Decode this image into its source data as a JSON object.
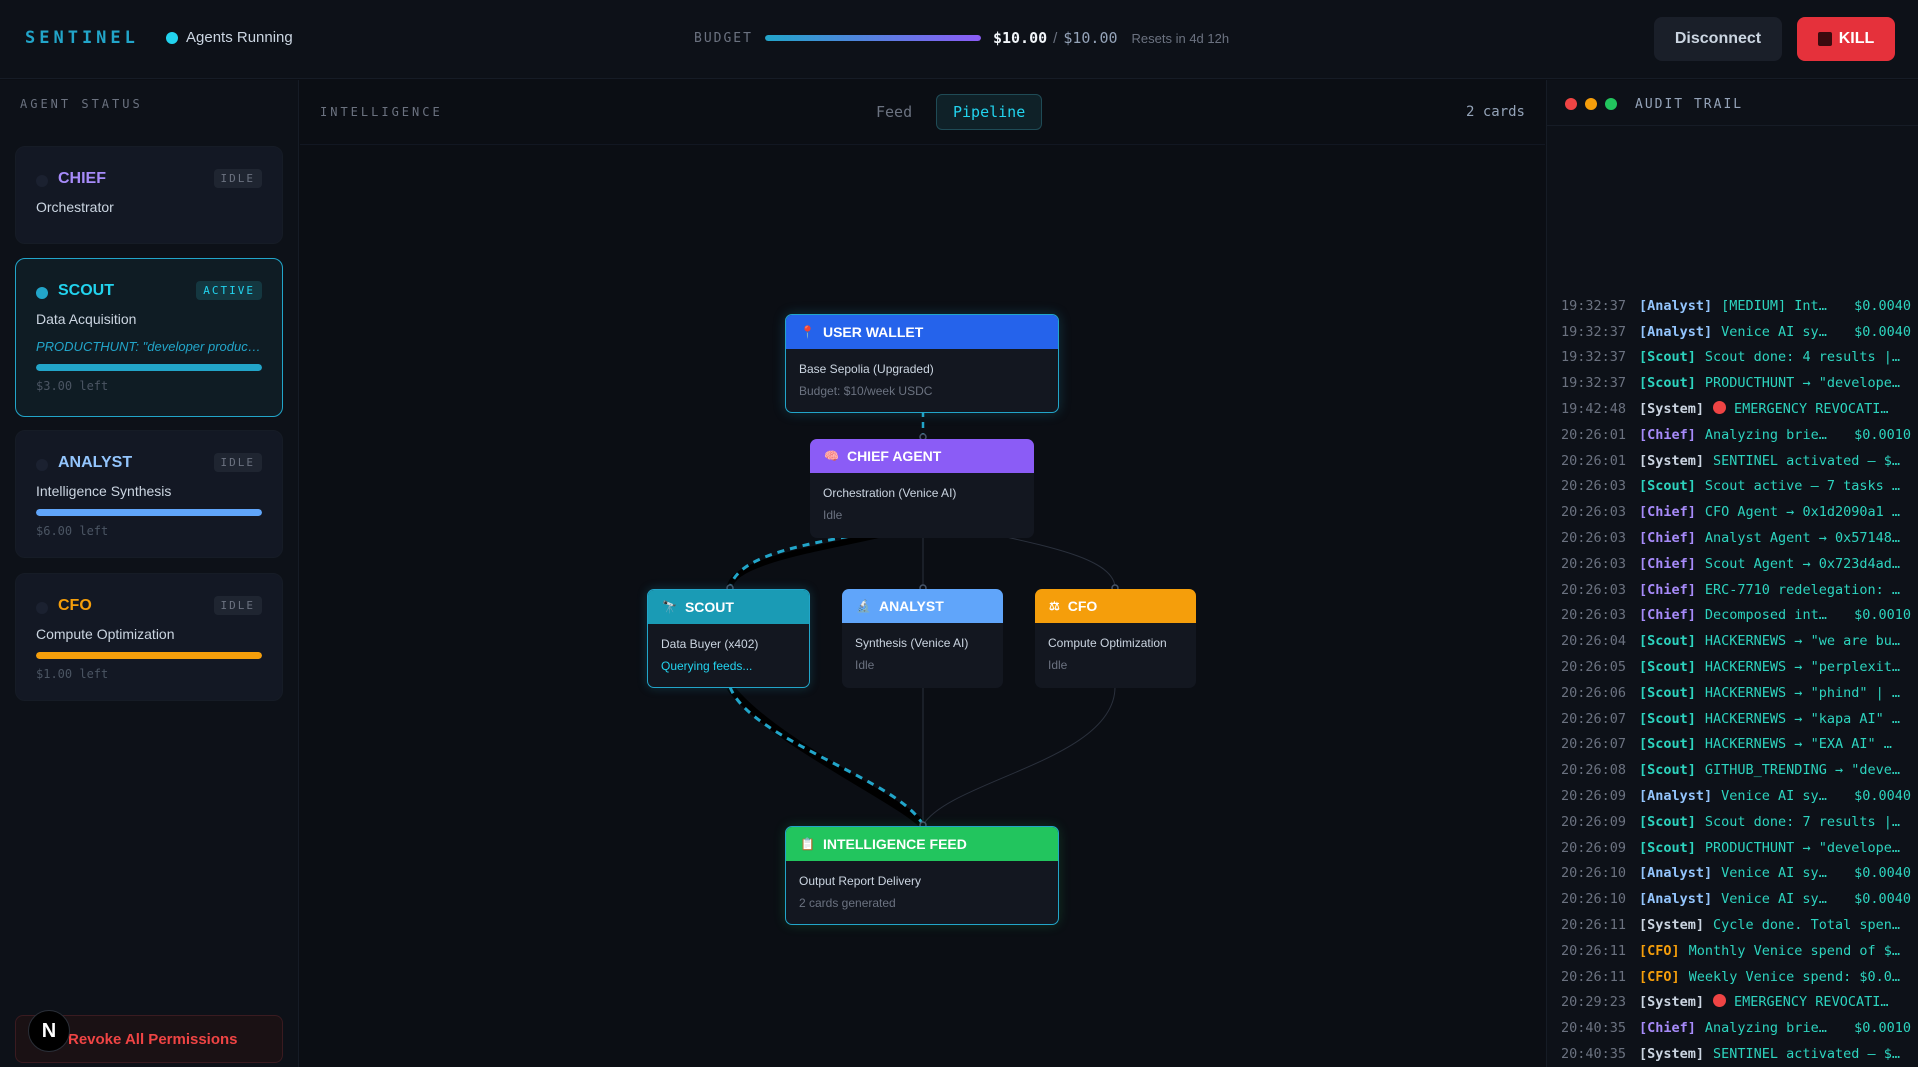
{
  "header": {
    "brand": "SENTINEL",
    "status": "Agents Running",
    "budget_label": "BUDGET",
    "budget_spent": "$10.00",
    "budget_sep": "/",
    "budget_total": "$10.00",
    "budget_fraction": 1.0,
    "budget_reset": "Resets in 4d 12h",
    "disconnect_label": "Disconnect",
    "kill_label": "KILL"
  },
  "sidebar": {
    "title": "AGENT STATUS",
    "agents": [
      {
        "name": "CHIEF",
        "role": "Orchestrator",
        "badge": "IDLE",
        "color": "#a78bfa"
      },
      {
        "name": "SCOUT",
        "role": "Data Acquisition",
        "badge": "ACTIVE",
        "note": "PRODUCTHUNT: \"developer product...",
        "left": "$3.00 left",
        "bar_fraction": 1.0,
        "color": "#22a5c9"
      },
      {
        "name": "ANALYST",
        "role": "Intelligence Synthesis",
        "badge": "IDLE",
        "left": "$6.00 left",
        "bar_fraction": 1.0,
        "color": "#60a5fa"
      },
      {
        "name": "CFO",
        "role": "Compute Optimization",
        "badge": "IDLE",
        "left": "$1.00 left",
        "bar_fraction": 1.0,
        "color": "#f59e0b"
      }
    ],
    "revoke_label": "Revoke All Permissions",
    "n_badge": "N"
  },
  "center": {
    "title": "INTELLIGENCE",
    "tabs": [
      "Feed",
      "Pipeline"
    ],
    "active_tab": "Pipeline",
    "cards_count": "2 cards",
    "nodes": {
      "wallet": {
        "title": "USER WALLET",
        "icon": "📍",
        "sub": "Base Sepolia (Upgraded)",
        "sub2": "Budget: $10/week USDC"
      },
      "chief": {
        "title": "CHIEF AGENT",
        "icon": "🧠",
        "sub": "Orchestration (Venice AI)",
        "sub2": "Idle"
      },
      "scout": {
        "title": "SCOUT",
        "icon": "🔭",
        "sub": "Data Buyer (x402)",
        "sub2": "Querying feeds..."
      },
      "analyst": {
        "title": "ANALYST",
        "icon": "🔬",
        "sub": "Synthesis (Venice AI)",
        "sub2": "Idle"
      },
      "cfo": {
        "title": "CFO",
        "icon": "⚖",
        "sub": "Compute Optimization",
        "sub2": "Idle"
      },
      "feed": {
        "title": "INTELLIGENCE FEED",
        "icon": "📋",
        "sub": "Output Report Delivery",
        "sub2": "2 cards generated"
      }
    }
  },
  "audit": {
    "title": "AUDIT TRAIL",
    "colors": {
      "Analyst": "#93c5fd",
      "Scout": "#2dd4bf",
      "System": "#cbd5e1",
      "Chief": "#a78bfa",
      "CFO": "#f59e0b"
    },
    "logs": [
      {
        "time": "19:32:37",
        "tag": "Analyst",
        "msg": "[MEDIUM] Int…",
        "cost": "$0.0040"
      },
      {
        "time": "19:32:37",
        "tag": "Analyst",
        "msg": "Venice AI sy…",
        "cost": "$0.0040"
      },
      {
        "time": "19:32:37",
        "tag": "Scout",
        "msg": "Scout done: 4 results |…",
        "cost": ""
      },
      {
        "time": "19:32:37",
        "tag": "Scout",
        "msg": "PRODUCTHUNT → \"develope…",
        "cost": ""
      },
      {
        "time": "19:42:48",
        "tag": "System",
        "msg": "EMERGENCY REVOCATI…",
        "cost": "",
        "red": true
      },
      {
        "time": "20:26:01",
        "tag": "Chief",
        "msg": "Analyzing brie…",
        "cost": "$0.0010"
      },
      {
        "time": "20:26:01",
        "tag": "System",
        "msg": "SENTINEL activated — $…",
        "cost": ""
      },
      {
        "time": "20:26:03",
        "tag": "Scout",
        "msg": "Scout active — 7 tasks …",
        "cost": ""
      },
      {
        "time": "20:26:03",
        "tag": "Chief",
        "msg": "CFO Agent → 0x1d2090a1 …",
        "cost": ""
      },
      {
        "time": "20:26:03",
        "tag": "Chief",
        "msg": "Analyst Agent → 0x57148…",
        "cost": ""
      },
      {
        "time": "20:26:03",
        "tag": "Chief",
        "msg": "Scout Agent → 0x723d4ad…",
        "cost": ""
      },
      {
        "time": "20:26:03",
        "tag": "Chief",
        "msg": "ERC-7710 redelegation: …",
        "cost": ""
      },
      {
        "time": "20:26:03",
        "tag": "Chief",
        "msg": "Decomposed int…",
        "cost": "$0.0010"
      },
      {
        "time": "20:26:04",
        "tag": "Scout",
        "msg": "HACKERNEWS → \"we are bu…",
        "cost": ""
      },
      {
        "time": "20:26:05",
        "tag": "Scout",
        "msg": "HACKERNEWS → \"perplexit…",
        "cost": ""
      },
      {
        "time": "20:26:06",
        "tag": "Scout",
        "msg": "HACKERNEWS → \"phind\" | …",
        "cost": ""
      },
      {
        "time": "20:26:07",
        "tag": "Scout",
        "msg": "HACKERNEWS → \"kapa AI\" …",
        "cost": ""
      },
      {
        "time": "20:26:07",
        "tag": "Scout",
        "msg": "HACKERNEWS → \"EXA AI\" …",
        "cost": ""
      },
      {
        "time": "20:26:08",
        "tag": "Scout",
        "msg": "GITHUB_TRENDING → \"deve…",
        "cost": ""
      },
      {
        "time": "20:26:09",
        "tag": "Analyst",
        "msg": "Venice AI sy…",
        "cost": "$0.0040"
      },
      {
        "time": "20:26:09",
        "tag": "Scout",
        "msg": "Scout done: 7 results |…",
        "cost": ""
      },
      {
        "time": "20:26:09",
        "tag": "Scout",
        "msg": "PRODUCTHUNT → \"develope…",
        "cost": ""
      },
      {
        "time": "20:26:10",
        "tag": "Analyst",
        "msg": "Venice AI sy…",
        "cost": "$0.0040"
      },
      {
        "time": "20:26:10",
        "tag": "Analyst",
        "msg": "Venice AI sy…",
        "cost": "$0.0040"
      },
      {
        "time": "20:26:11",
        "tag": "System",
        "msg": "Cycle done. Total spen…",
        "cost": ""
      },
      {
        "time": "20:26:11",
        "tag": "CFO",
        "msg": "Monthly Venice spend of $…",
        "cost": ""
      },
      {
        "time": "20:26:11",
        "tag": "CFO",
        "msg": "Weekly Venice spend: $0.0…",
        "cost": ""
      },
      {
        "time": "20:29:23",
        "tag": "System",
        "msg": "EMERGENCY REVOCATI…",
        "cost": "",
        "red": true
      },
      {
        "time": "20:40:35",
        "tag": "Chief",
        "msg": "Analyzing brie…",
        "cost": "$0.0010"
      },
      {
        "time": "20:40:35",
        "tag": "System",
        "msg": "SENTINEL activated — $…",
        "cost": ""
      }
    ]
  }
}
